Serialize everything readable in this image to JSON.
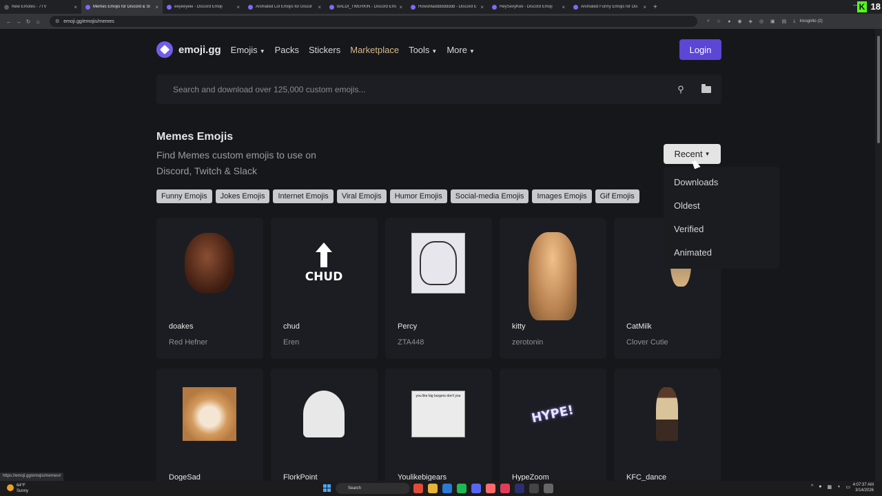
{
  "browser": {
    "tabs": [
      {
        "title": "New Emotes - 7TV",
        "active": false
      },
      {
        "title": "Memes Emojis for Discord & Sl",
        "active": true
      },
      {
        "title": "eeyeeyeei - Discord Emoji",
        "active": false
      },
      {
        "title": "Animated Lol Emojis for Discor",
        "active": false
      },
      {
        "title": "BALDI_TWERKIN - Discord Emo",
        "active": false
      },
      {
        "title": "HowsMaddddddddd - Discord E",
        "active": false
      },
      {
        "title": "HeySexyKek - Discord Emoji",
        "active": false
      },
      {
        "title": "Animated Funny Emojis for Dis",
        "active": false
      }
    ],
    "url": "emoji.gg/emojis/memes",
    "incognito_label": "Incognito (2)",
    "overlay_number": "18",
    "status_url": "https://emoji.gg/emojis/memes#"
  },
  "nav": {
    "brand": "emoji.gg",
    "items": [
      {
        "label": "Emojis",
        "dropdown": true
      },
      {
        "label": "Packs",
        "dropdown": false
      },
      {
        "label": "Stickers",
        "dropdown": false
      },
      {
        "label": "Marketplace",
        "dropdown": false
      },
      {
        "label": "Tools",
        "dropdown": true
      },
      {
        "label": "More",
        "dropdown": true
      }
    ],
    "login_label": "Login"
  },
  "search": {
    "placeholder": "Search and download over 125,000 custom emojis..."
  },
  "header": {
    "title": "Memes Emojis",
    "subtitle": "Find Memes custom emojis to use on Discord, Twitch & Slack"
  },
  "sort": {
    "selected": "Recent",
    "options": [
      "Downloads",
      "Oldest",
      "Verified",
      "Animated"
    ]
  },
  "tags": [
    "Funny Emojis",
    "Jokes Emojis",
    "Internet Emojis",
    "Viral Emojis",
    "Humor Emojis",
    "Social-media Emojis",
    "Images Emojis",
    "Gif Emojis"
  ],
  "emojis": [
    {
      "name": "doakes",
      "author": "Red Hefner",
      "art": "face"
    },
    {
      "name": "chud",
      "author": "Eren",
      "art": "chud"
    },
    {
      "name": "Percy",
      "author": "ZTA448",
      "art": "percy"
    },
    {
      "name": "kitty",
      "author": "zerotonin",
      "art": "kitty"
    },
    {
      "name": "CatMilk",
      "author": "Clover Cutie",
      "art": "catmilk"
    },
    {
      "name": "DogeSad",
      "author": "",
      "art": "doge"
    },
    {
      "name": "FlorkPoint",
      "author": "",
      "art": "flork"
    },
    {
      "name": "Youlikebigears",
      "author": "",
      "art": "burgers"
    },
    {
      "name": "HypeZoom",
      "author": "",
      "art": "hype"
    },
    {
      "name": "KFC_dance",
      "author": "",
      "art": "kfc"
    }
  ],
  "emoji_art_text": {
    "chud_word": "CHUD",
    "burgers_caption": "you like big burgers don't you",
    "hype_word": "HYPE!"
  },
  "taskbar": {
    "weather_temp": "64°F",
    "weather_desc": "Sunny",
    "search_label": "Search",
    "time": "4:07:37 AM",
    "date": "3/14/2026"
  }
}
